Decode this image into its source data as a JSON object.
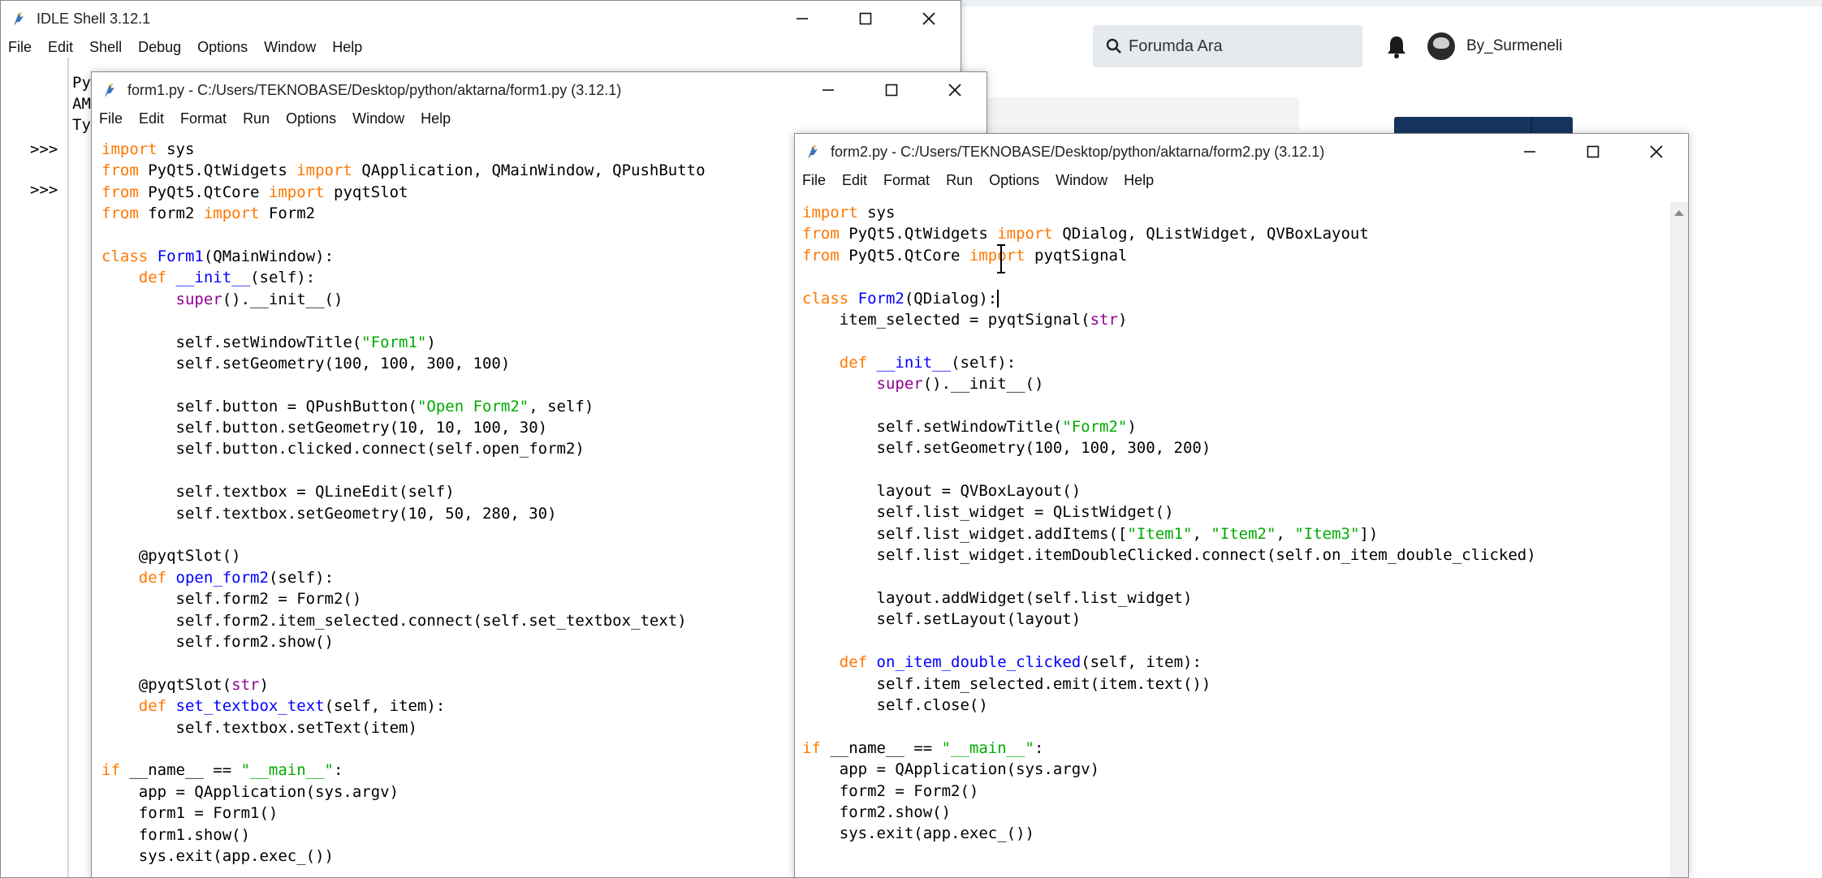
{
  "background_page": {
    "search_placeholder": "Forumda Ara",
    "username": "By_Surmeneli",
    "icons": [
      "search-icon",
      "bell-icon",
      "avatar"
    ]
  },
  "shell": {
    "title": "IDLE Shell 3.12.1",
    "menu": [
      "File",
      "Edit",
      "Shell",
      "Debug",
      "Options",
      "Window",
      "Help"
    ],
    "prompts": [
      ">>>",
      ">>>"
    ],
    "peek_lines": [
      "Py",
      "AM",
      "Ty"
    ]
  },
  "form1": {
    "title": "form1.py - C:/Users/TEKNOBASE/Desktop/python/aktarna/form1.py (3.12.1)",
    "menu": [
      "File",
      "Edit",
      "Format",
      "Run",
      "Options",
      "Window",
      "Help"
    ],
    "code_lines": [
      [
        [
          "import",
          "kw"
        ],
        [
          " sys",
          ""
        ]
      ],
      [
        [
          "from",
          "kw"
        ],
        [
          " PyQt5.QtWidgets ",
          ""
        ],
        [
          "import",
          "kw"
        ],
        [
          " QApplication, QMainWindow, QPushButto",
          ""
        ]
      ],
      [
        [
          "from",
          "kw"
        ],
        [
          " PyQt5.QtCore ",
          ""
        ],
        [
          "import",
          "kw"
        ],
        [
          " pyqtSlot",
          ""
        ]
      ],
      [
        [
          "from",
          "kw"
        ],
        [
          " form2 ",
          ""
        ],
        [
          "import",
          "kw"
        ],
        [
          " Form2",
          ""
        ]
      ],
      [],
      [
        [
          "class",
          "kw"
        ],
        [
          " ",
          ""
        ],
        [
          "Form1",
          "def"
        ],
        [
          "(QMainWindow):",
          ""
        ]
      ],
      [
        [
          "    ",
          ""
        ],
        [
          "def",
          "kw"
        ],
        [
          " ",
          ""
        ],
        [
          "__init__",
          "def"
        ],
        [
          "(self):",
          ""
        ]
      ],
      [
        [
          "        ",
          ""
        ],
        [
          "super",
          "bi"
        ],
        [
          "().__init__()",
          ""
        ]
      ],
      [],
      [
        [
          "        self.setWindowTitle(",
          ""
        ],
        [
          "\"Form1\"",
          "str"
        ],
        [
          ")",
          ""
        ]
      ],
      [
        [
          "        self.setGeometry(100, 100, 300, 100)",
          ""
        ]
      ],
      [],
      [
        [
          "        self.button = QPushButton(",
          ""
        ],
        [
          "\"Open Form2\"",
          "str"
        ],
        [
          ", self)",
          ""
        ]
      ],
      [
        [
          "        self.button.setGeometry(10, 10, 100, 30)",
          ""
        ]
      ],
      [
        [
          "        self.button.clicked.connect(self.open_form2)",
          ""
        ]
      ],
      [],
      [
        [
          "        self.textbox = QLineEdit(self)",
          ""
        ]
      ],
      [
        [
          "        self.textbox.setGeometry(10, 50, 280, 30)",
          ""
        ]
      ],
      [],
      [
        [
          "    @pyqtSlot()",
          ""
        ]
      ],
      [
        [
          "    ",
          ""
        ],
        [
          "def",
          "kw"
        ],
        [
          " ",
          ""
        ],
        [
          "open_form2",
          "def"
        ],
        [
          "(self):",
          ""
        ]
      ],
      [
        [
          "        self.form2 = Form2()",
          ""
        ]
      ],
      [
        [
          "        self.form2.item_selected.connect(self.set_textbox_text)",
          ""
        ]
      ],
      [
        [
          "        self.form2.show()",
          ""
        ]
      ],
      [],
      [
        [
          "    @pyqtSlot(",
          ""
        ],
        [
          "str",
          "bi"
        ],
        [
          ")",
          ""
        ]
      ],
      [
        [
          "    ",
          ""
        ],
        [
          "def",
          "kw"
        ],
        [
          " ",
          ""
        ],
        [
          "set_textbox_text",
          "def"
        ],
        [
          "(self, item):",
          ""
        ]
      ],
      [
        [
          "        self.textbox.setText(item)",
          ""
        ]
      ],
      [],
      [
        [
          "if",
          "kw"
        ],
        [
          " __name__ == ",
          ""
        ],
        [
          "\"__main__\"",
          "str"
        ],
        [
          ":",
          ""
        ]
      ],
      [
        [
          "    app = QApplication(sys.argv)",
          ""
        ]
      ],
      [
        [
          "    form1 = Form1()",
          ""
        ]
      ],
      [
        [
          "    form1.show()",
          ""
        ]
      ],
      [
        [
          "    sys.exit(app.exec_())",
          ""
        ]
      ]
    ]
  },
  "form2": {
    "title": "form2.py - C:/Users/TEKNOBASE/Desktop/python/aktarna/form2.py (3.12.1)",
    "menu": [
      "File",
      "Edit",
      "Format",
      "Run",
      "Options",
      "Window",
      "Help"
    ],
    "code_lines": [
      [
        [
          "import",
          "kw"
        ],
        [
          " sys",
          ""
        ]
      ],
      [
        [
          "from",
          "kw"
        ],
        [
          " PyQt5.QtWidgets ",
          ""
        ],
        [
          "import",
          "kw"
        ],
        [
          " QDialog, QListWidget, QVBoxLayout",
          ""
        ]
      ],
      [
        [
          "from",
          "kw"
        ],
        [
          " PyQt5.QtCore ",
          ""
        ],
        [
          "import",
          "kw"
        ],
        [
          " pyqtSignal",
          ""
        ]
      ],
      [],
      [
        [
          "class",
          "kw"
        ],
        [
          " ",
          ""
        ],
        [
          "Form2",
          "def"
        ],
        [
          "(QDialog):",
          ""
        ],
        [
          "",
          "caret"
        ]
      ],
      [
        [
          "    item_selected = pyqtSignal(",
          ""
        ],
        [
          "str",
          "bi"
        ],
        [
          ")",
          ""
        ]
      ],
      [],
      [
        [
          "    ",
          ""
        ],
        [
          "def",
          "kw"
        ],
        [
          " ",
          ""
        ],
        [
          "__init__",
          "def"
        ],
        [
          "(self):",
          ""
        ]
      ],
      [
        [
          "        ",
          ""
        ],
        [
          "super",
          "bi"
        ],
        [
          "().__init__()",
          ""
        ]
      ],
      [],
      [
        [
          "        self.setWindowTitle(",
          ""
        ],
        [
          "\"Form2\"",
          "str"
        ],
        [
          ")",
          ""
        ]
      ],
      [
        [
          "        self.setGeometry(100, 100, 300, 200)",
          ""
        ]
      ],
      [],
      [
        [
          "        layout = QVBoxLayout()",
          ""
        ]
      ],
      [
        [
          "        self.list_widget = QListWidget()",
          ""
        ]
      ],
      [
        [
          "        self.list_widget.addItems([",
          ""
        ],
        [
          "\"Item1\"",
          "str"
        ],
        [
          ", ",
          ""
        ],
        [
          "\"Item2\"",
          "str"
        ],
        [
          ", ",
          ""
        ],
        [
          "\"Item3\"",
          "str"
        ],
        [
          "])",
          ""
        ]
      ],
      [
        [
          "        self.list_widget.itemDoubleClicked.connect(self.on_item_double_clicked)",
          ""
        ]
      ],
      [],
      [
        [
          "        layout.addWidget(self.list_widget)",
          ""
        ]
      ],
      [
        [
          "        self.setLayout(layout)",
          ""
        ]
      ],
      [],
      [
        [
          "    ",
          ""
        ],
        [
          "def",
          "kw"
        ],
        [
          " ",
          ""
        ],
        [
          "on_item_double_clicked",
          "def"
        ],
        [
          "(self, item):",
          ""
        ]
      ],
      [
        [
          "        self.item_selected.emit(item.text())",
          ""
        ]
      ],
      [
        [
          "        self.close()",
          ""
        ]
      ],
      [],
      [
        [
          "if",
          "kw"
        ],
        [
          " __name__ == ",
          ""
        ],
        [
          "\"__main__\"",
          "str"
        ],
        [
          ":",
          ""
        ]
      ],
      [
        [
          "    app = QApplication(sys.argv)",
          ""
        ]
      ],
      [
        [
          "    form2 = Form2()",
          ""
        ]
      ],
      [
        [
          "    form2.show()",
          ""
        ]
      ],
      [
        [
          "    sys.exit(app.exec_())",
          ""
        ]
      ]
    ]
  }
}
